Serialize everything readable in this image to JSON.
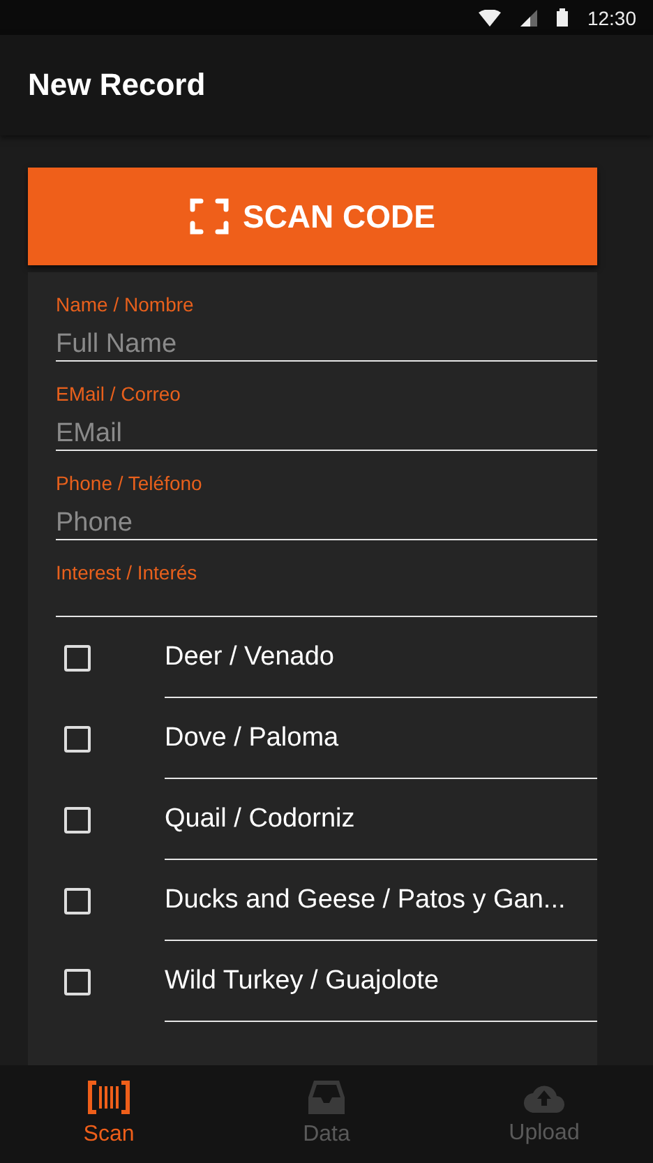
{
  "status_bar": {
    "time": "12:30"
  },
  "app_bar": {
    "title": "New Record"
  },
  "scan_button": {
    "label": "SCAN CODE"
  },
  "fields": [
    {
      "label": "Name / Nombre",
      "placeholder": "Full Name"
    },
    {
      "label": "EMail / Correo",
      "placeholder": "EMail"
    },
    {
      "label": "Phone / Teléfono",
      "placeholder": "Phone"
    }
  ],
  "interest": {
    "label": "Interest / Interés",
    "options": [
      {
        "label": "Deer / Venado",
        "checked": false
      },
      {
        "label": "Dove / Paloma",
        "checked": false
      },
      {
        "label": "Quail / Codorniz",
        "checked": false
      },
      {
        "label": "Ducks and Geese / Patos y Gan...",
        "checked": false
      },
      {
        "label": "Wild Turkey / Guajolote",
        "checked": false
      }
    ]
  },
  "bottom_nav": [
    {
      "label": "Scan",
      "kind": "scan",
      "selected": true
    },
    {
      "label": "Data",
      "kind": "data",
      "selected": false
    },
    {
      "label": "Upload",
      "kind": "upload",
      "selected": false
    }
  ]
}
